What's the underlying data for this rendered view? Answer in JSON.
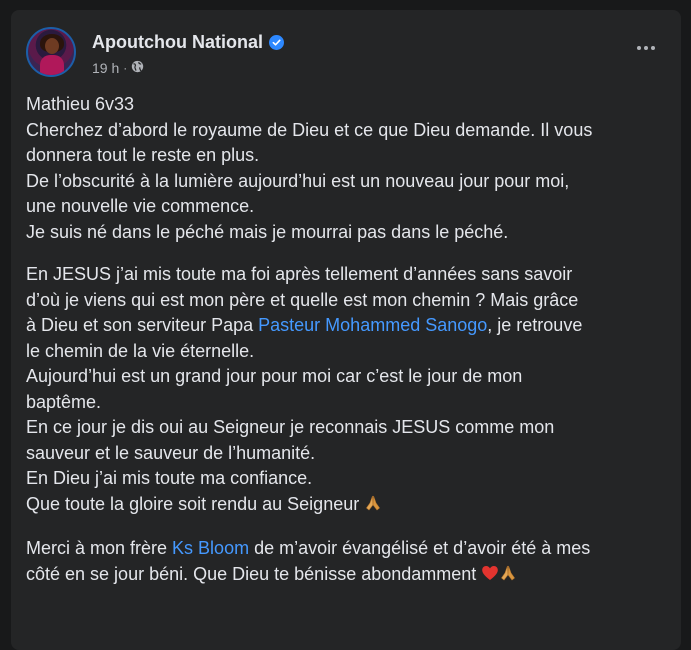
{
  "post": {
    "author": "Apoutchou National",
    "verified_icon": "verified-badge-icon",
    "time": "19 h",
    "separator": "·",
    "audience_icon": "globe-icon",
    "more_icon": "more-options-icon",
    "paragraphs": [
      {
        "lines": [
          "Mathieu 6v33",
          "Cherchez d’abord le royaume de Dieu et ce que Dieu demande. Il vous",
          "donnera tout le reste en plus.",
          "De l’obscurité à la lumière aujourd’hui est un nouveau jour pour moi,",
          "une nouvelle vie commence.",
          "Je suis né dans le péché mais je mourrai pas dans le péché."
        ]
      },
      {
        "line1": "En JESUS j’ai mis toute ma foi après tellement d’années sans savoir",
        "line2": "d’où je viens qui est mon père et quelle est mon chemin ? Mais grâce",
        "line3_before": "à Dieu et son serviteur Papa ",
        "line3_link": "Pasteur Mohammed Sanogo",
        "line3_after": ", je retrouve",
        "line4": "le chemin de la vie éternelle.",
        "line5": "Aujourd’hui est un grand jour pour moi car c’est le jour de mon",
        "line6": "baptême.",
        "line7": "En ce jour je dis oui au Seigneur je reconnais JESUS  comme mon",
        "line8": "sauveur et le sauveur de l’humanité.",
        "line9": "En Dieu j’ai mis toute ma confiance.",
        "line10": "Que toute la gloire soit rendu au Seigneur",
        "line10_emoji": "praying-hands-icon"
      },
      {
        "line1_before": "Merci à mon frère ",
        "line1_link": "Ks Bloom",
        "line1_after": " de m’avoir évangélisé et d’avoir été à mes",
        "line2": "côté en se jour béni. Que Dieu te bénisse abondamment",
        "line2_emojis": [
          "red-heart-icon",
          "praying-hands-icon"
        ]
      }
    ]
  },
  "colors": {
    "page_bg": "#18191a",
    "card_bg": "#242526",
    "text_primary": "#e4e6eb",
    "text_secondary": "#b0b3b8",
    "link": "#4599ff",
    "verified": "#2d88ff"
  }
}
